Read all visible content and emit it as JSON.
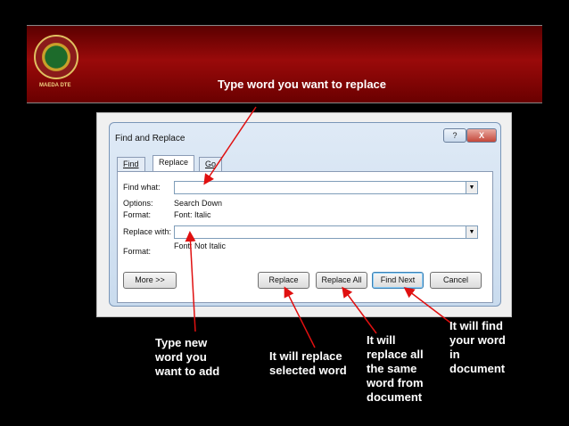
{
  "banner": {
    "title": "Type word you want to replace",
    "logo_text": "MAEDA DTE"
  },
  "dialog": {
    "title": "Find and Replace",
    "help_button": "?",
    "close_button": "X",
    "tabs": [
      "Find",
      "Replace",
      "Go To"
    ],
    "find_what_label": "Find what:",
    "options_label": "Options:",
    "options_value": "Search Down",
    "format_label": "Format:",
    "format_value": "Font: Italic",
    "replace_with_label": "Replace with:",
    "format2_label": "Format:",
    "format2_value": "Font: Not Italic",
    "more_button": "More >>",
    "replace_button": "Replace",
    "replace_all_button": "Replace All",
    "find_next_button": "Find Next",
    "cancel_button": "Cancel"
  },
  "annotations": {
    "type_new": "Type new\nword you\nwant to add",
    "replace_selected": "It will replace\nselected word",
    "replace_all": "It will\nreplace all\nthe same\nword from\ndocument",
    "find_word": "It will find\nyour word\nin\ndocument"
  },
  "colors": {
    "banner": "#8b0a0a",
    "arrow": "#e01010",
    "background": "#000000"
  }
}
